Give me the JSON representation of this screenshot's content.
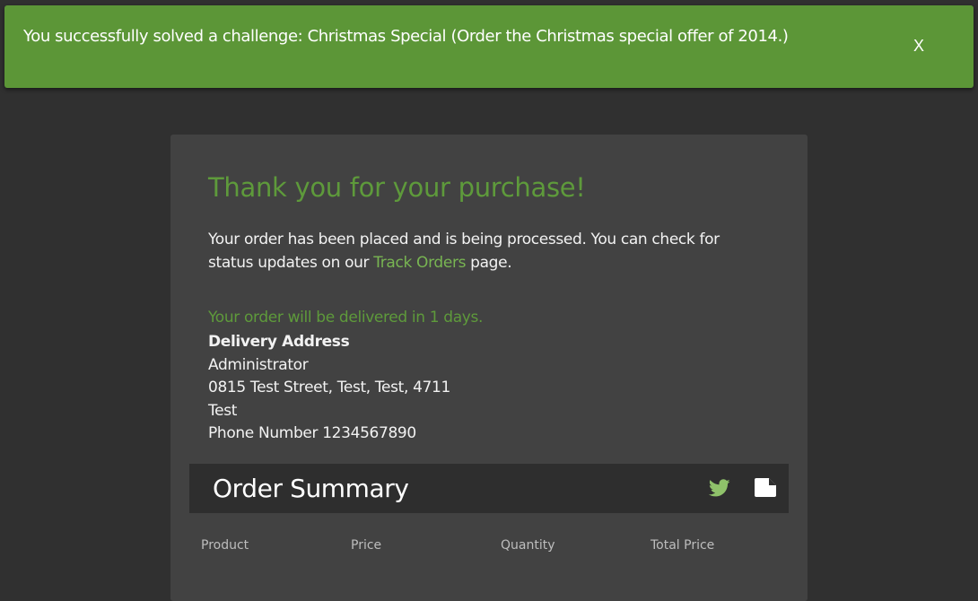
{
  "banner": {
    "message": "You successfully solved a challenge: Christmas Special (Order the Christmas special offer of 2014.)",
    "close_label": "X",
    "color": "#5c9637"
  },
  "confirmation": {
    "title": "Thank you for your purchase!",
    "message_before_link": "Your order has been placed and is being processed. You can check for status updates on our ",
    "link_text": "Track Orders",
    "message_after_link": " page.",
    "delivery_notice": "Your order will be delivered in 1 days.",
    "accent_color": "#5e9a3b"
  },
  "address": {
    "heading": "Delivery Address",
    "name": "Administrator",
    "street": "0815 Test Street, Test, Test, 4711",
    "country": "Test",
    "phone": "Phone Number 1234567890"
  },
  "summary": {
    "title": "Order Summary",
    "icons": [
      "twitter-icon",
      "print-icon"
    ],
    "columns": [
      "Product",
      "Price",
      "Quantity",
      "Total Price"
    ]
  }
}
